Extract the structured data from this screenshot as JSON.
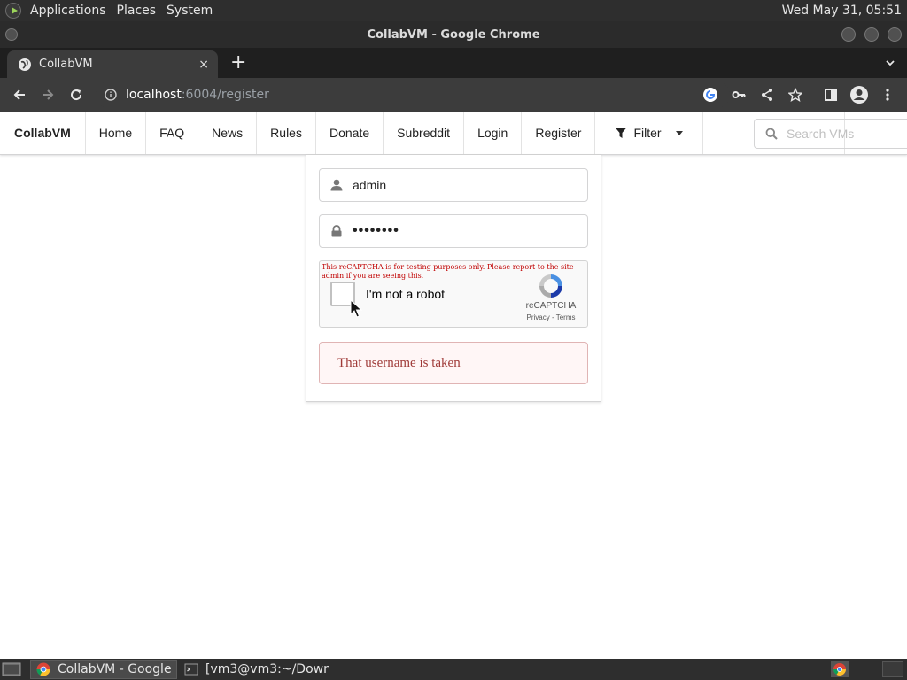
{
  "panel": {
    "menus": [
      "Applications",
      "Places",
      "System"
    ],
    "clock": "Wed May 31, 05:51"
  },
  "window": {
    "title": "CollabVM - Google Chrome"
  },
  "browser": {
    "tab_title": "CollabVM",
    "tab_close": "×",
    "new_tab": "+",
    "url_host": "localhost",
    "url_rest": ":6004/register"
  },
  "site_nav": {
    "brand": "CollabVM",
    "items": [
      "Home",
      "FAQ",
      "News",
      "Rules",
      "Donate",
      "Subreddit",
      "Login",
      "Register"
    ],
    "filter_label": "Filter",
    "search_placeholder": "Search VMs"
  },
  "form": {
    "username_value": "admin",
    "password_value": "••••••••",
    "recaptcha": {
      "warning": "This reCAPTCHA is for testing purposes only. Please report to the site admin if you are seeing this.",
      "label": "I'm not a robot",
      "brand": "reCAPTCHA",
      "links": "Privacy - Terms"
    },
    "error": "That username is taken"
  },
  "taskbar": {
    "tasks": [
      "CollabVM - Google ...",
      "[vm3@vm3:~/Down..."
    ]
  },
  "colors": {
    "error_text": "#9f3a38",
    "error_bg": "#fff6f6",
    "panel_bg": "#2e2e2e",
    "chrome_toolbar": "#3c3c3c"
  }
}
